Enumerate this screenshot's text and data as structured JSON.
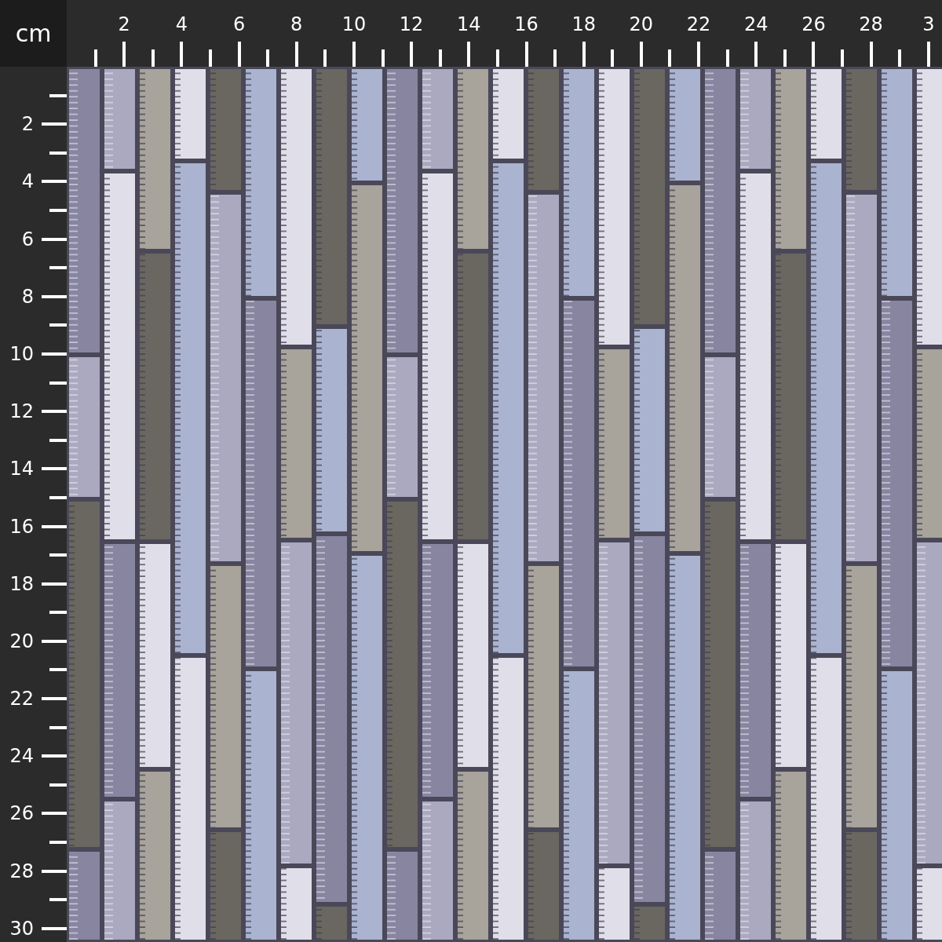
{
  "unit_label": "cm",
  "top_ruler": {
    "labels": [
      "2",
      "4",
      "6",
      "8",
      "10",
      "12",
      "14",
      "16",
      "18",
      "20",
      "22",
      "24",
      "26",
      "28",
      "3"
    ]
  },
  "left_ruler": {
    "labels": [
      "2",
      "4",
      "6",
      "8",
      "10",
      "12",
      "14",
      "16",
      "18",
      "20",
      "22",
      "24",
      "26",
      "28",
      "30"
    ]
  }
}
